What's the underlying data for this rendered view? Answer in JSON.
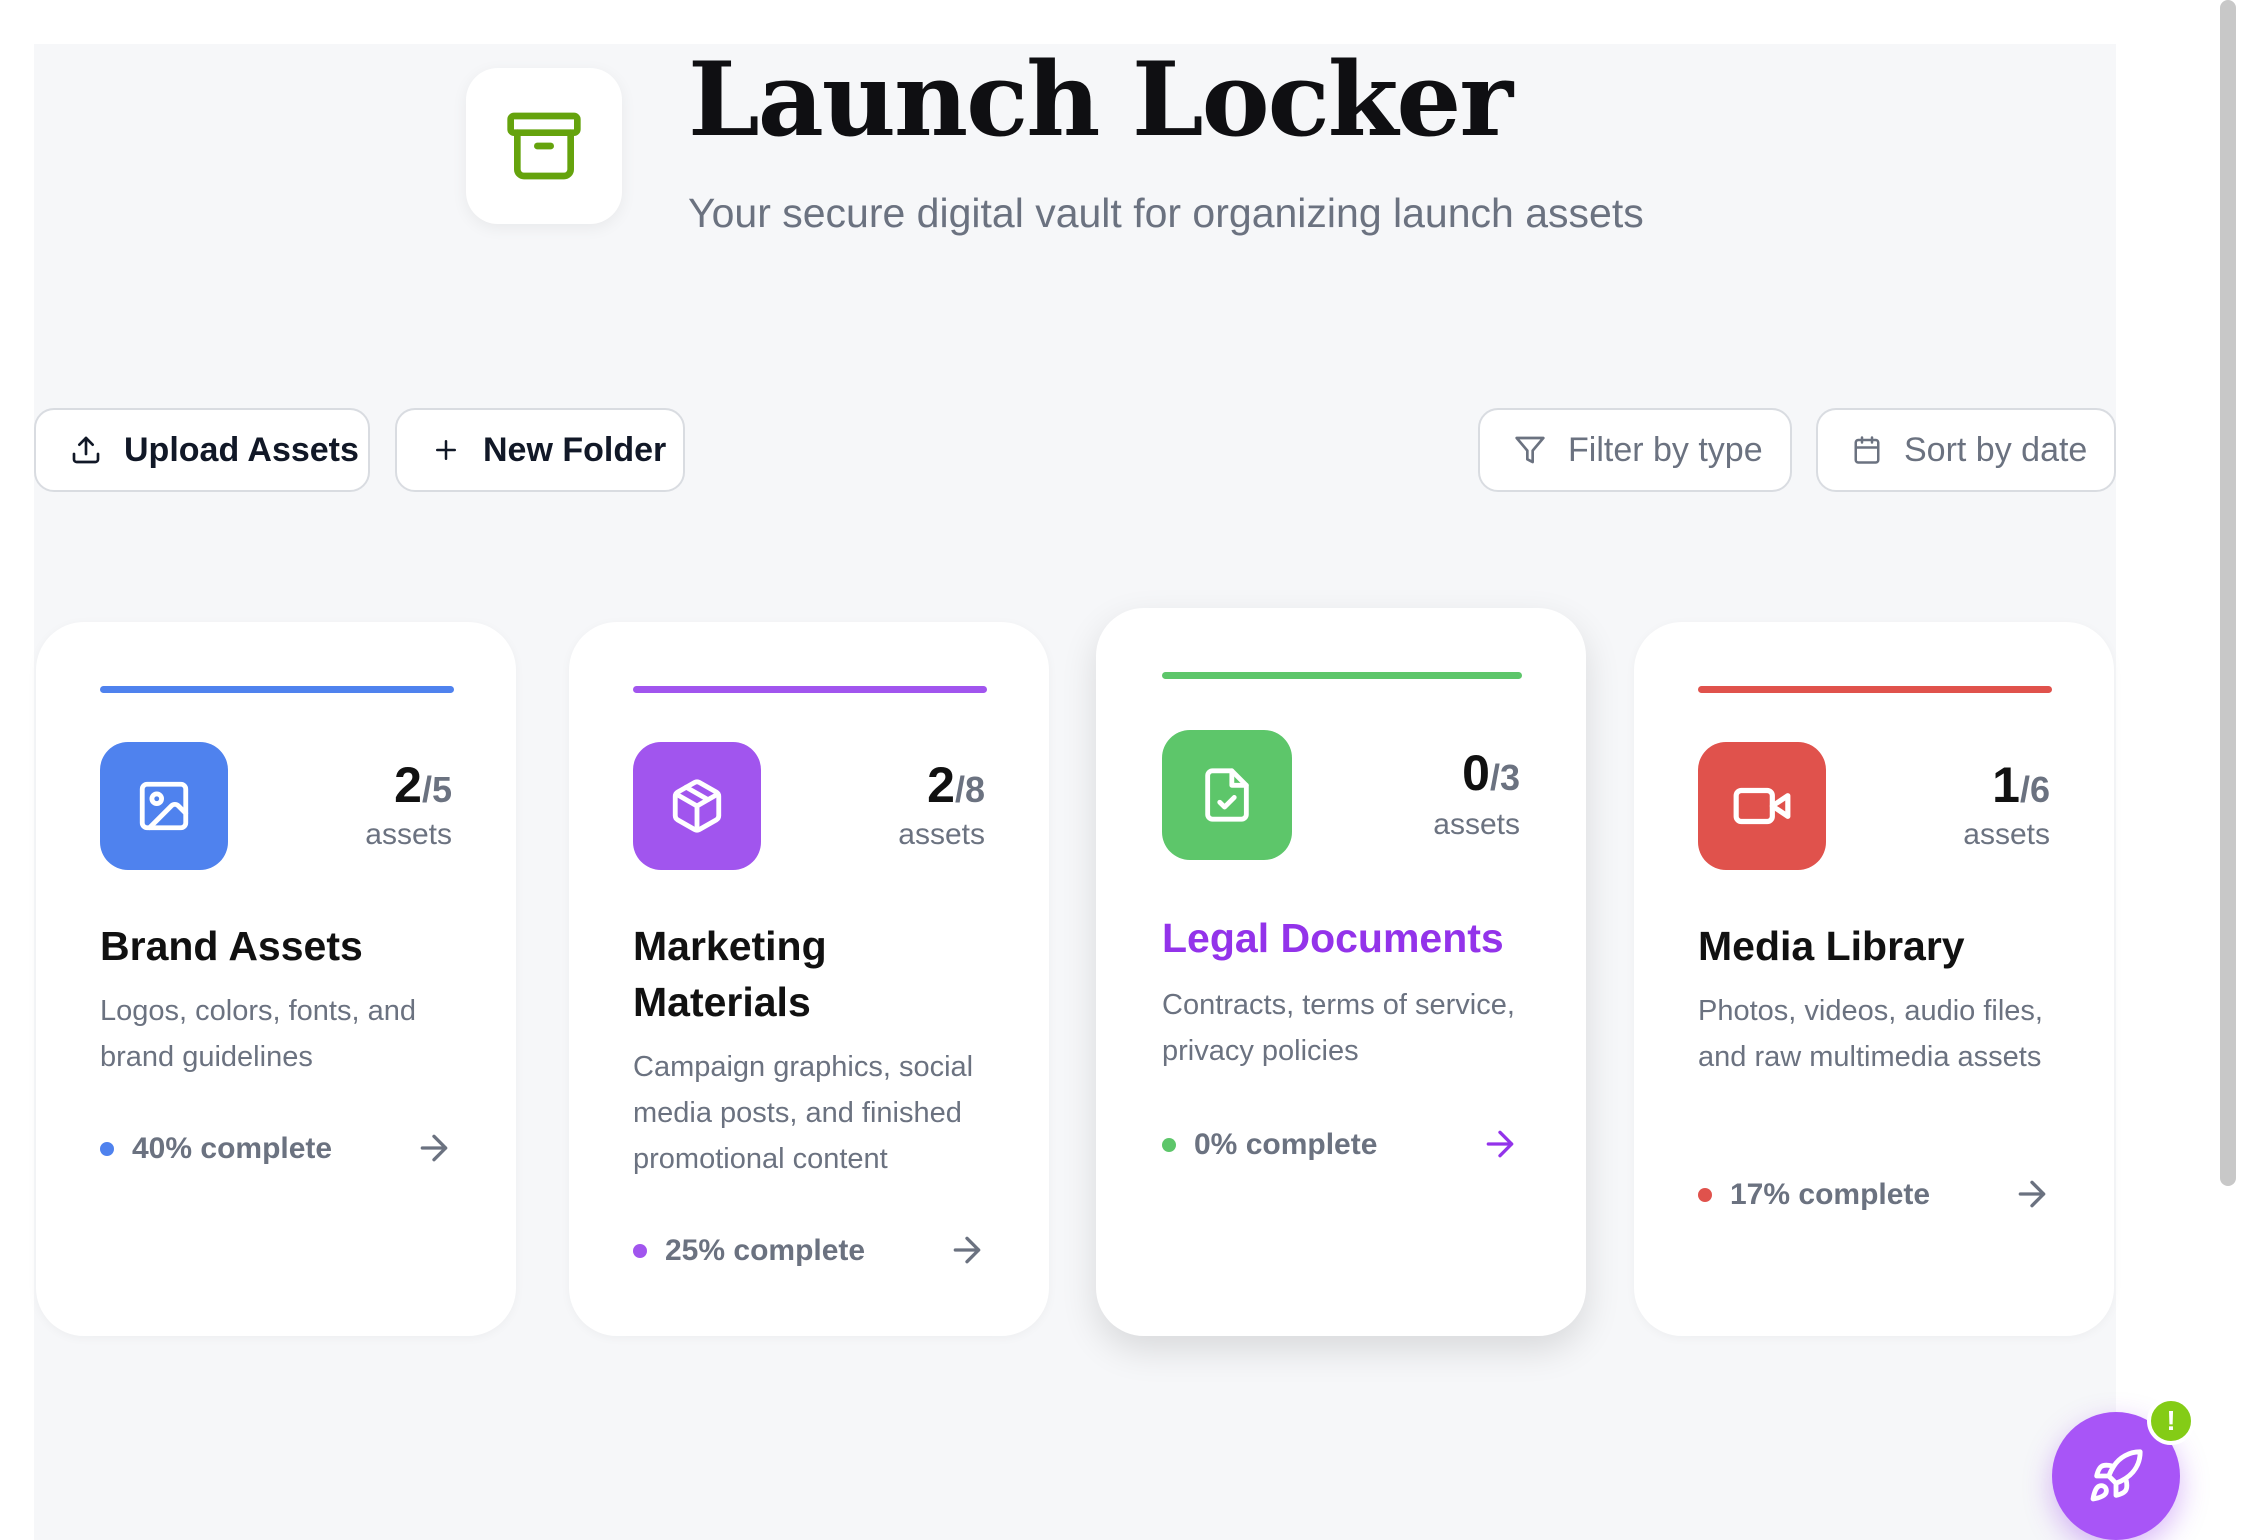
{
  "header": {
    "icon": "archive-icon",
    "title": "Launch Locker",
    "subtitle": "Your secure digital vault for organizing launch assets"
  },
  "toolbar": {
    "upload_label": "Upload Assets",
    "upload_icon": "upload-icon",
    "new_folder_label": "New Folder",
    "new_folder_icon": "plus-icon",
    "filter_label": "Filter by type",
    "filter_icon": "filter-icon",
    "sort_label": "Sort by date",
    "sort_icon": "calendar-icon"
  },
  "cards": [
    {
      "title": "Brand Assets",
      "description": "Logos, colors, fonts, and brand guidelines",
      "count": "2",
      "total": "/5",
      "count_label": "assets",
      "progress_text": "40% complete",
      "progress": 0.4,
      "icon": "image-icon",
      "color": "#4f82ee"
    },
    {
      "title": "Marketing Materials",
      "description": "Campaign graphics, social media posts, and finished promotional content",
      "count": "2",
      "total": "/8",
      "count_label": "assets",
      "progress_text": "25% complete",
      "progress": 0.25,
      "icon": "package-icon",
      "color": "#a155ee"
    },
    {
      "title": "Legal Documents",
      "description": "Contracts, terms of service, privacy policies",
      "count": "0",
      "total": "/3",
      "count_label": "assets",
      "progress_text": "0% complete",
      "progress": 0,
      "icon": "file-check-icon",
      "color": "#5dc66a",
      "title_color": "#9333ea"
    },
    {
      "title": "Media Library",
      "description": "Photos, videos, audio files, and raw multimedia assets",
      "count": "1",
      "total": "/6",
      "count_label": "assets",
      "progress_text": "17% complete",
      "progress": 0.17,
      "icon": "video-icon",
      "color": "#e0524c"
    }
  ],
  "fab": {
    "icon": "rocket-icon",
    "badge": "!",
    "color": "#a855f7",
    "badge_color": "#84cc16"
  }
}
